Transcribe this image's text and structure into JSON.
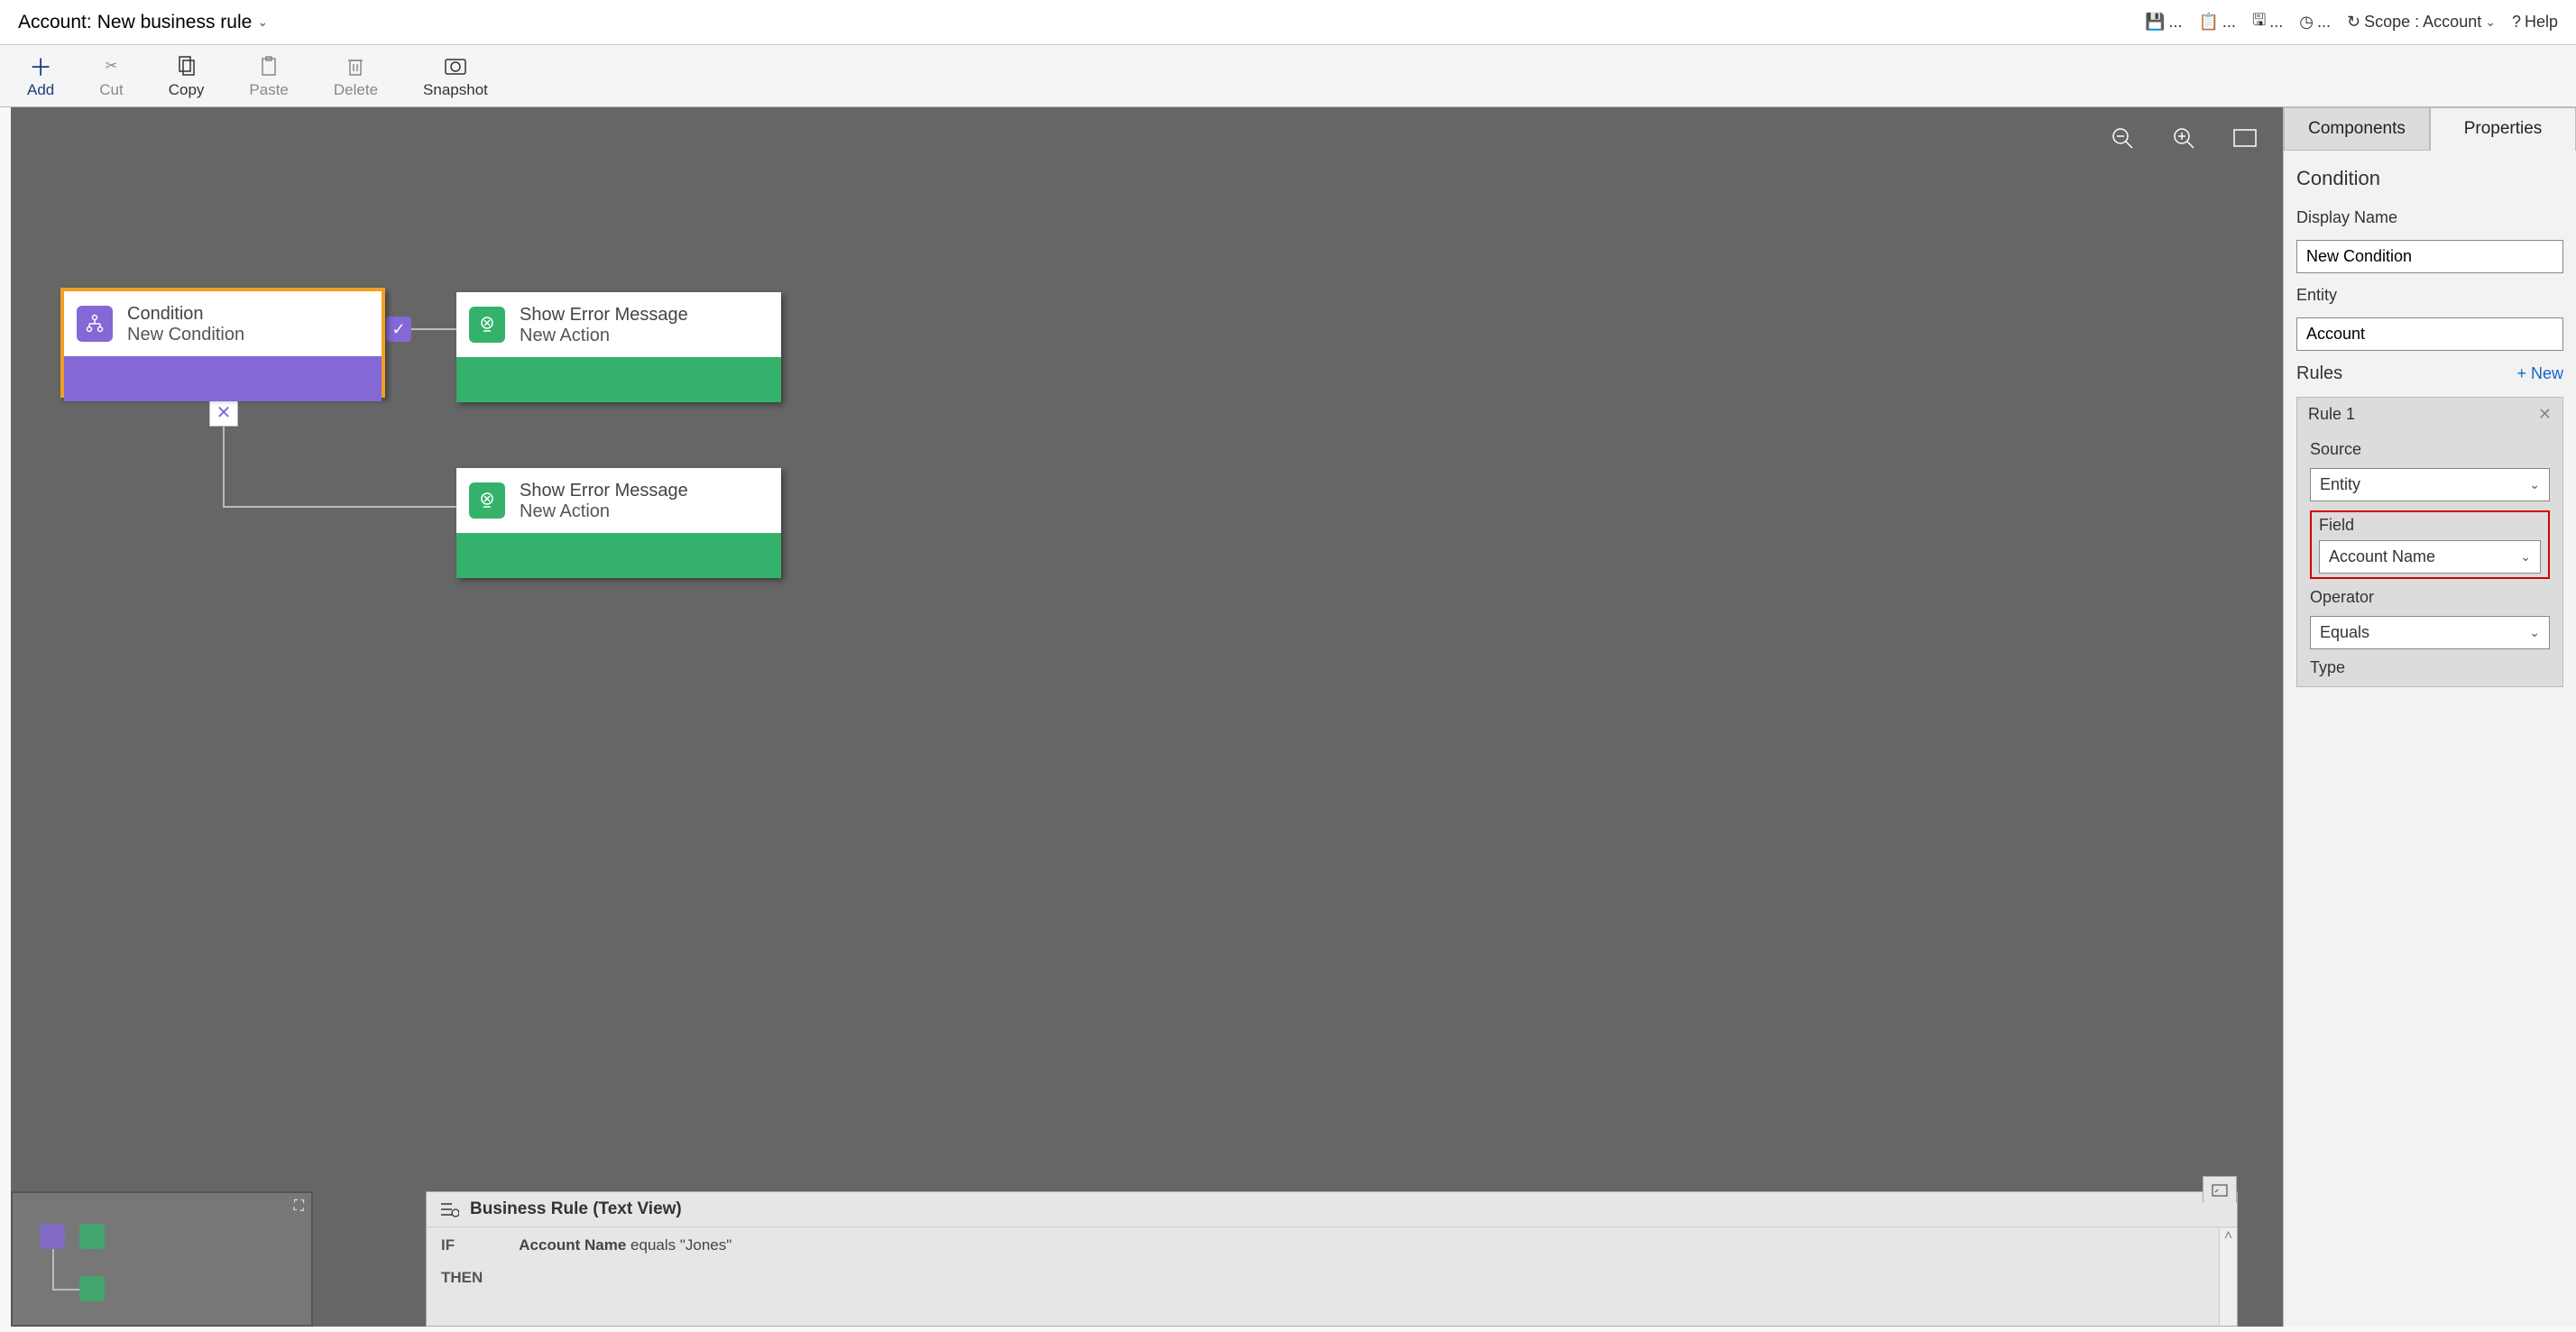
{
  "header": {
    "entity": "Account:",
    "rule_name": "New business rule",
    "scope_label": "Scope :",
    "scope_value": "Account",
    "help": "Help"
  },
  "toolbar": {
    "add": "Add",
    "cut": "Cut",
    "copy": "Copy",
    "paste": "Paste",
    "delete": "Delete",
    "snapshot": "Snapshot"
  },
  "canvas": {
    "condition": {
      "title": "Condition",
      "sub": "New Condition"
    },
    "action1": {
      "title": "Show Error Message",
      "sub": "New Action"
    },
    "action2": {
      "title": "Show Error Message",
      "sub": "New Action"
    }
  },
  "textview": {
    "header": "Business Rule (Text View)",
    "if": "IF",
    "then": "THEN",
    "if_stmt_field": "Account Name",
    "if_stmt_rest": " equals \"Jones\""
  },
  "panel": {
    "tab_components": "Components",
    "tab_properties": "Properties",
    "section": "Condition",
    "display_name_label": "Display Name",
    "display_name_value": "New Condition",
    "entity_label": "Entity",
    "entity_value": "Account",
    "rules_label": "Rules",
    "new_label": "+  New",
    "rule1": "Rule 1",
    "source_label": "Source",
    "source_value": "Entity",
    "field_label": "Field",
    "field_value": "Account Name",
    "operator_label": "Operator",
    "operator_value": "Equals",
    "type_label": "Type"
  }
}
